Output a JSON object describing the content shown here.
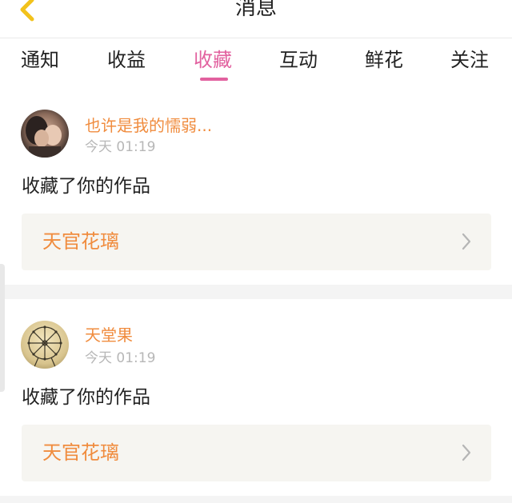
{
  "header": {
    "title": "消息",
    "back_icon": "chevron-left-icon",
    "back_icon_color": "#f2c21b"
  },
  "tabs": [
    {
      "label": "通知",
      "active": false
    },
    {
      "label": "收益",
      "active": false
    },
    {
      "label": "收藏",
      "active": true
    },
    {
      "label": "互动",
      "active": false
    },
    {
      "label": "鲜花",
      "active": false
    },
    {
      "label": "关注",
      "active": false
    }
  ],
  "colors": {
    "accent_pink": "#e2619f",
    "username_orange": "#f08c3e",
    "work_box_bg": "#f6f5f1",
    "divider_gray": "#f4f4f4"
  },
  "notifications": [
    {
      "username": "也许是我的懦弱...",
      "time": "今天 01:19",
      "action": "收藏了你的作品",
      "work_title": "天官花璃",
      "avatar": "avatar-photo"
    },
    {
      "username": "天堂果",
      "time": "今天 01:19",
      "action": "收藏了你的作品",
      "work_title": "天官花璃",
      "avatar": "ferris-wheel-avatar"
    }
  ]
}
